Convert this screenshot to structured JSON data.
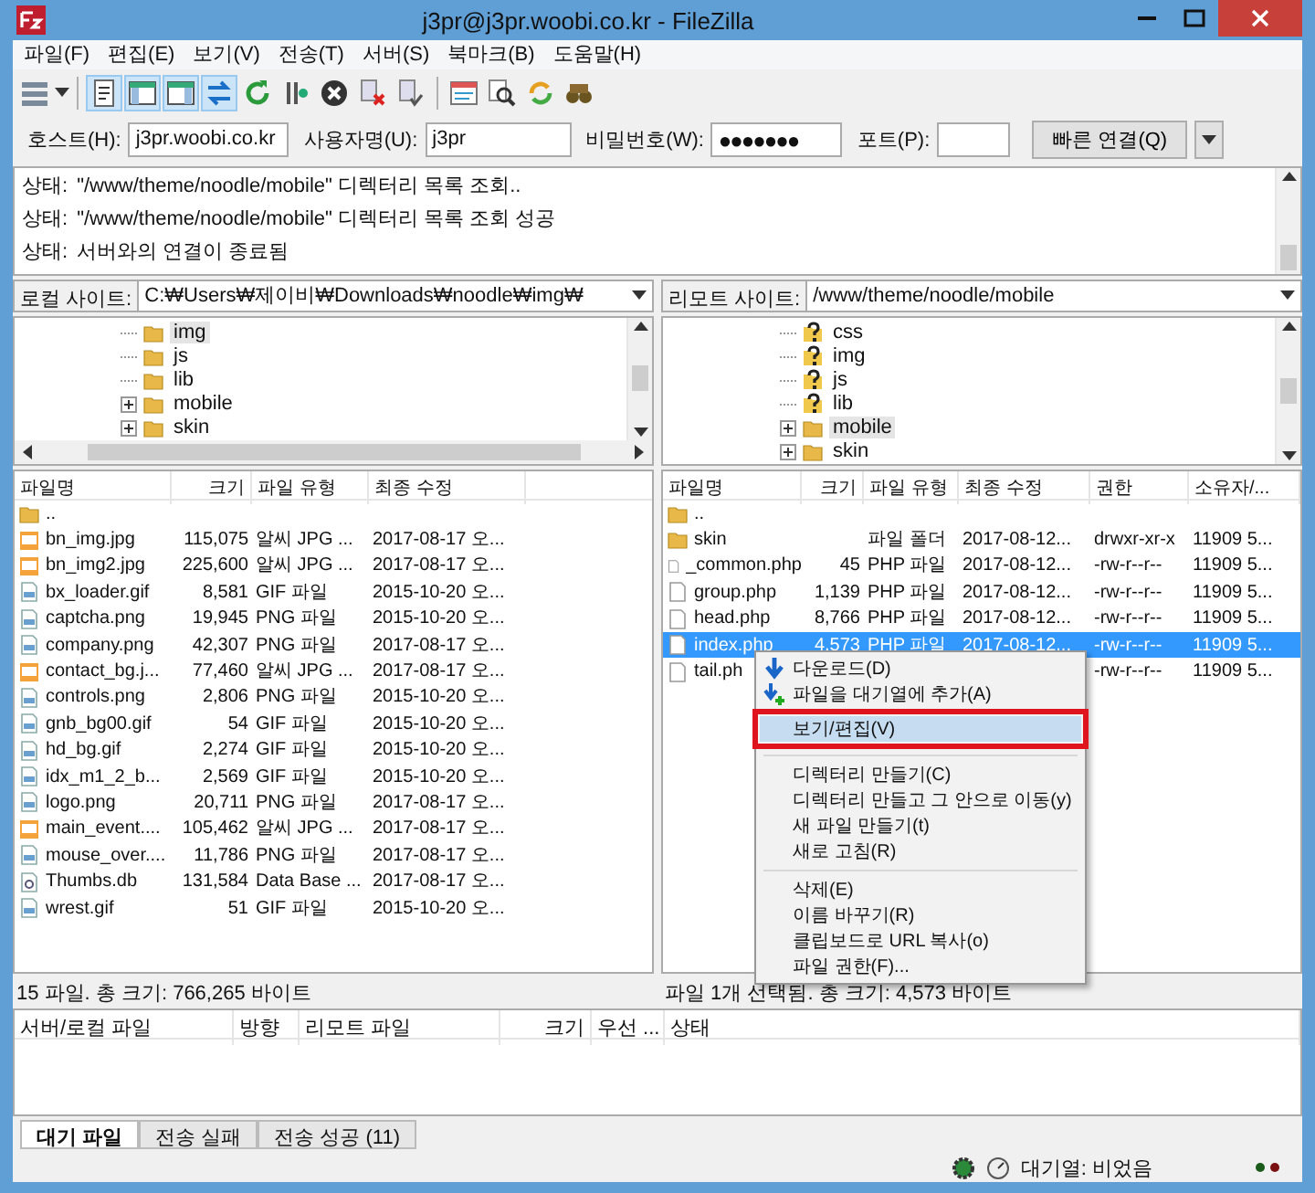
{
  "window": {
    "title": "j3pr@j3pr.woobi.co.kr - FileZilla"
  },
  "menu": [
    "파일(F)",
    "편집(E)",
    "보기(V)",
    "전송(T)",
    "서버(S)",
    "북마크(B)",
    "도움말(H)"
  ],
  "toolbar": [
    {
      "kind": "sites",
      "on": false
    },
    {
      "kind": "sep"
    },
    {
      "kind": "log",
      "on": true
    },
    {
      "kind": "local-tree",
      "on": true
    },
    {
      "kind": "remote-tree",
      "on": true
    },
    {
      "kind": "queue",
      "on": true
    },
    {
      "kind": "refresh",
      "on": false
    },
    {
      "kind": "process",
      "on": false
    },
    {
      "kind": "cancel",
      "on": false
    },
    {
      "kind": "disconnect",
      "on": false
    },
    {
      "kind": "reconnect",
      "on": false
    },
    {
      "kind": "sep"
    },
    {
      "kind": "filter",
      "on": false
    },
    {
      "kind": "compare",
      "on": false
    },
    {
      "kind": "sync",
      "on": false
    },
    {
      "kind": "find",
      "on": false
    }
  ],
  "quickconnect": {
    "fields": [
      {
        "label": "호스트(H):",
        "value": "j3pr.woobi.co.kr",
        "kind": "text"
      },
      {
        "label": "사용자명(U):",
        "value": "j3pr",
        "kind": "text"
      },
      {
        "label": "비밀번호(W):",
        "value": "●●●●●●●",
        "kind": "password"
      },
      {
        "label": "포트(P):",
        "kind": "port"
      }
    ],
    "button": "빠른 연결(Q)"
  },
  "log": [
    {
      "label": "상태:",
      "message": "\"/www/theme/noodle/mobile\" 디렉터리 목록 조회.."
    },
    {
      "label": "상태:",
      "message": "\"/www/theme/noodle/mobile\" 디렉터리 목록 조회 성공"
    },
    {
      "label": "상태:",
      "message": "서버와의 연결이 종료됨"
    }
  ],
  "local": {
    "site_label": "로컬 사이트:",
    "path": "C:₩Users₩제이비₩Downloads₩noodle₩img₩",
    "tree": [
      {
        "name": "img",
        "kind": "folder",
        "collapsed": false,
        "selected": true
      },
      {
        "name": "js",
        "kind": "folder",
        "collapsed": false,
        "selected": false
      },
      {
        "name": "lib",
        "kind": "folder",
        "collapsed": false,
        "selected": false
      },
      {
        "name": "mobile",
        "kind": "folder",
        "collapsed": true,
        "selected": false
      },
      {
        "name": "skin",
        "kind": "folder",
        "collapsed": true,
        "selected": false
      }
    ],
    "columns": [
      "파일명",
      "크기",
      "파일 유형",
      "최종 수정"
    ],
    "rows": [
      {
        "kind": "folder",
        "selected": false,
        "cells": [
          "..",
          "",
          "",
          ""
        ]
      },
      {
        "kind": "jpg",
        "selected": false,
        "cells": [
          "bn_img.jpg",
          "115,075",
          "알씨 JPG ...",
          "2017-08-17 오..."
        ]
      },
      {
        "kind": "jpg",
        "selected": false,
        "cells": [
          "bn_img2.jpg",
          "225,600",
          "알씨 JPG ...",
          "2017-08-17 오..."
        ]
      },
      {
        "kind": "image",
        "selected": false,
        "cells": [
          "bx_loader.gif",
          "8,581",
          "GIF 파일",
          "2015-10-20 오..."
        ]
      },
      {
        "kind": "image",
        "selected": false,
        "cells": [
          "captcha.png",
          "19,945",
          "PNG 파일",
          "2015-10-20 오..."
        ]
      },
      {
        "kind": "image",
        "selected": false,
        "cells": [
          "company.png",
          "42,307",
          "PNG 파일",
          "2017-08-17 오..."
        ]
      },
      {
        "kind": "jpg",
        "selected": false,
        "cells": [
          "contact_bg.j...",
          "77,460",
          "알씨 JPG ...",
          "2017-08-17 오..."
        ]
      },
      {
        "kind": "image",
        "selected": false,
        "cells": [
          "controls.png",
          "2,806",
          "PNG 파일",
          "2015-10-20 오..."
        ]
      },
      {
        "kind": "image",
        "selected": false,
        "cells": [
          "gnb_bg00.gif",
          "54",
          "GIF 파일",
          "2015-10-20 오..."
        ]
      },
      {
        "kind": "image",
        "selected": false,
        "cells": [
          "hd_bg.gif",
          "2,274",
          "GIF 파일",
          "2015-10-20 오..."
        ]
      },
      {
        "kind": "image",
        "selected": false,
        "cells": [
          "idx_m1_2_b...",
          "2,569",
          "GIF 파일",
          "2015-10-20 오..."
        ]
      },
      {
        "kind": "image",
        "selected": false,
        "cells": [
          "logo.png",
          "20,711",
          "PNG 파일",
          "2017-08-17 오..."
        ]
      },
      {
        "kind": "jpg",
        "selected": false,
        "cells": [
          "main_event....",
          "105,462",
          "알씨 JPG ...",
          "2017-08-17 오..."
        ]
      },
      {
        "kind": "image",
        "selected": false,
        "cells": [
          "mouse_over....",
          "11,786",
          "PNG 파일",
          "2017-08-17 오..."
        ]
      },
      {
        "kind": "db",
        "selected": false,
        "cells": [
          "Thumbs.db",
          "131,584",
          "Data Base ...",
          "2017-08-17 오..."
        ]
      },
      {
        "kind": "image",
        "selected": false,
        "cells": [
          "wrest.gif",
          "51",
          "GIF 파일",
          "2015-10-20 오..."
        ]
      }
    ],
    "status": "15 파일. 총 크기: 766,265 바이트"
  },
  "remote": {
    "site_label": "리모트 사이트:",
    "path": "/www/theme/noodle/mobile",
    "tree": [
      {
        "name": "css",
        "kind": "unknown",
        "collapsed": false,
        "selected": false
      },
      {
        "name": "img",
        "kind": "unknown",
        "collapsed": false,
        "selected": false
      },
      {
        "name": "js",
        "kind": "unknown",
        "collapsed": false,
        "selected": false
      },
      {
        "name": "lib",
        "kind": "unknown",
        "collapsed": false,
        "selected": false
      },
      {
        "name": "mobile",
        "kind": "folder",
        "collapsed": true,
        "selected": true
      },
      {
        "name": "skin",
        "kind": "folder",
        "collapsed": true,
        "selected": false
      }
    ],
    "columns": [
      "파일명",
      "크기",
      "파일 유형",
      "최종 수정",
      "권한",
      "소유자/..."
    ],
    "rows": [
      {
        "kind": "folder",
        "selected": false,
        "cells": [
          "..",
          "",
          "",
          "",
          "",
          ""
        ]
      },
      {
        "kind": "folder",
        "selected": false,
        "cells": [
          "skin",
          "",
          "파일 폴더",
          "2017-08-12...",
          "drwxr-xr-x",
          "11909 5..."
        ]
      },
      {
        "kind": "php",
        "selected": false,
        "cells": [
          "_common.php",
          "45",
          "PHP 파일",
          "2017-08-12...",
          "-rw-r--r--",
          "11909 5..."
        ]
      },
      {
        "kind": "php",
        "selected": false,
        "cells": [
          "group.php",
          "1,139",
          "PHP 파일",
          "2017-08-12...",
          "-rw-r--r--",
          "11909 5..."
        ]
      },
      {
        "kind": "php",
        "selected": false,
        "cells": [
          "head.php",
          "8,766",
          "PHP 파일",
          "2017-08-12...",
          "-rw-r--r--",
          "11909 5..."
        ]
      },
      {
        "kind": "php",
        "selected": true,
        "cells": [
          "index.php",
          "4,573",
          "PHP 파일",
          "2017-08-12...",
          "-rw-r--r--",
          "11909 5..."
        ]
      },
      {
        "kind": "php",
        "selected": false,
        "cells": [
          "tail.ph",
          "",
          "",
          "",
          "-rw-r--r--",
          "11909 5..."
        ]
      }
    ],
    "status": "파일 1개 선택됨. 총 크기: 4,573 바이트",
    "context_menu": [
      {
        "items": [
          {
            "label": "다운로드(D)",
            "kind": "download",
            "selected": false
          },
          {
            "label": "파일을 대기열에 추가(A)",
            "kind": "enqueue",
            "selected": false
          },
          {
            "label": "보기/편집(V)",
            "kind": "plain",
            "selected": true
          }
        ]
      },
      {
        "items": [
          {
            "label": "디렉터리 만들기(C)",
            "kind": "plain",
            "selected": false
          },
          {
            "label": "디렉터리 만들고 그 안으로 이동(y)",
            "kind": "plain",
            "selected": false
          },
          {
            "label": "새 파일 만들기(t)",
            "kind": "plain",
            "selected": false
          },
          {
            "label": "새로 고침(R)",
            "kind": "plain",
            "selected": false
          }
        ]
      },
      {
        "items": [
          {
            "label": "삭제(E)",
            "kind": "plain",
            "selected": false
          },
          {
            "label": "이름 바꾸기(R)",
            "kind": "plain",
            "selected": false
          },
          {
            "label": "클립보드로 URL 복사(o)",
            "kind": "plain",
            "selected": false
          },
          {
            "label": "파일 권한(F)...",
            "kind": "plain",
            "selected": false
          }
        ]
      }
    ]
  },
  "queue": {
    "columns": [
      "서버/로컬 파일",
      "방향",
      "리모트 파일",
      "크기",
      "우선 ...",
      "상태"
    ],
    "tabs": [
      {
        "label": "대기 파일",
        "selected": true
      },
      {
        "label": "전송 실패",
        "selected": false
      },
      {
        "label": "전송 성공 (11)",
        "selected": false
      }
    ]
  },
  "status_bar": {
    "queue": "대기열: 비었음"
  }
}
